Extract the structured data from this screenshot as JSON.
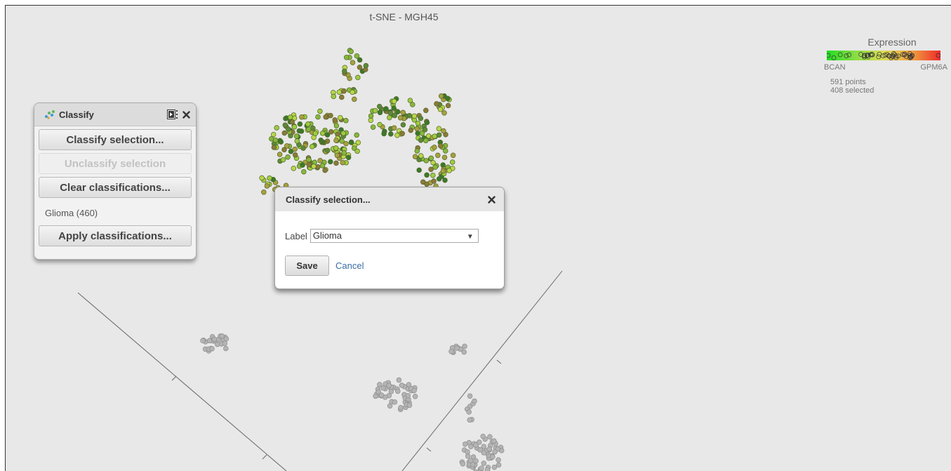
{
  "plot": {
    "title": "t-SNE - MGH45"
  },
  "legend": {
    "title": "Expression",
    "low_label": "BCAN",
    "high_label": "GPM6A",
    "points_text": "591 points",
    "selected_text": "408 selected",
    "gradient_colors": [
      "#22dd22",
      "#88dd44",
      "#dddd55",
      "#f0a040",
      "#ee2a2a"
    ]
  },
  "classify_panel": {
    "title": "Classify",
    "icon": "classify-scatter-icon",
    "header_icons": [
      "expand-icon",
      "close-icon"
    ],
    "buttons": {
      "classify_selection": "Classify selection...",
      "unclassify_selection": "Unclassify selection",
      "clear_classifications": "Clear classifications...",
      "apply_classifications": "Apply classifications..."
    },
    "classifications": [
      "Glioma (460)"
    ]
  },
  "dialog": {
    "title": "Classify selection...",
    "label_text": "Label",
    "label_value": "Glioma",
    "save_label": "Save",
    "cancel_label": "Cancel",
    "close_icon": "close-icon"
  },
  "colors": {
    "selected_point_palette": [
      "#b8d84a",
      "#9ccc40",
      "#86b83c",
      "#a8a040",
      "#8a7a3a",
      "#5a8a3a",
      "#3a7a2a"
    ],
    "unselected_point": "#b4b4b4",
    "link": "#3a6ea5",
    "background": "#e8e8e8"
  }
}
